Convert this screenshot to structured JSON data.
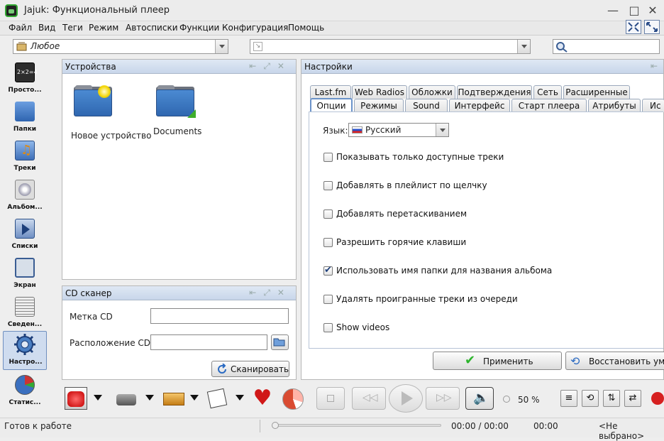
{
  "window": {
    "title": "Jajuk: Функциональный плеер",
    "buttons": [
      "✕",
      "□",
      "—"
    ]
  },
  "menu": [
    "Файл",
    "Вид",
    "Теги",
    "Режим",
    "Автосписки",
    "Функции",
    "Конфигурация",
    "Помощь"
  ],
  "filter": {
    "ambience_value": "Любое",
    "search_placeholder": ""
  },
  "perspectives": [
    {
      "label": "Просто...",
      "icon": "simple-icon"
    },
    {
      "label": "Папки",
      "icon": "folders-icon"
    },
    {
      "label": "Треки",
      "icon": "tracks-icon"
    },
    {
      "label": "Альбом...",
      "icon": "albums-icon"
    },
    {
      "label": "Списки",
      "icon": "playlists-icon"
    },
    {
      "label": "Экран",
      "icon": "display-icon"
    },
    {
      "label": "Сведен...",
      "icon": "info-icon"
    },
    {
      "label": "Настро...",
      "icon": "configuration-icon",
      "selected": true
    },
    {
      "label": "Статис...",
      "icon": "statistics-icon"
    }
  ],
  "devices_panel": {
    "title": "Устройства",
    "items": [
      {
        "label": "Новое устройство",
        "icon": "new-device-folder-icon"
      },
      {
        "label": "Documents",
        "icon": "documents-folder-icon"
      }
    ]
  },
  "cd_panel": {
    "title": "CD сканер",
    "label_field": "Метка CD",
    "location_field": "Расположение CD:",
    "scan_button": "Сканировать"
  },
  "settings_panel": {
    "title": "Настройки",
    "tabs_row1": [
      "Last.fm",
      "Web Radios",
      "Обложки",
      "Подтверждения",
      "Сеть",
      "Расширенные"
    ],
    "tabs_row2": [
      "Опции",
      "Режимы",
      "Sound",
      "Интерфейс",
      "Старт плеера",
      "Атрибуты",
      "Ис"
    ],
    "active_tab": "Опции",
    "language_label": "Язык:",
    "language_value": "Русский",
    "options": [
      {
        "label": "Показывать только доступные треки",
        "checked": false
      },
      {
        "label": "Добавлять в плейлист по щелчку",
        "checked": false
      },
      {
        "label": "Добавлять перетаскиванием",
        "checked": false
      },
      {
        "label": "Разрешить горячие клавиши",
        "checked": false
      },
      {
        "label": "Использовать имя папки для названия альбома",
        "checked": true
      },
      {
        "label": "Удалять проигранные треки из очереди",
        "checked": false
      },
      {
        "label": "Show videos",
        "checked": false
      }
    ],
    "apply_button": "Применить",
    "restore_button": "Восстановить умо..."
  },
  "player": {
    "volume": "50 %"
  },
  "status": {
    "left": "Готов к работе",
    "time": "00:00 / 00:00",
    "remaining": "00:00",
    "selection": "<Не выбрано>"
  }
}
